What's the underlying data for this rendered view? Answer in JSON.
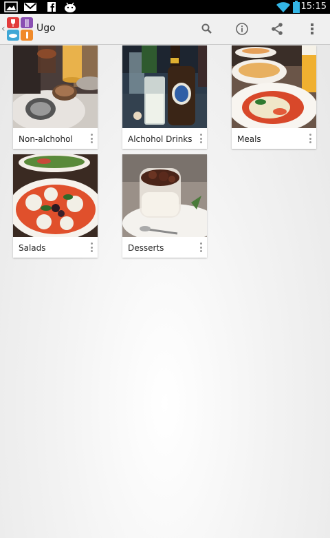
{
  "status_bar": {
    "time": "15:15",
    "icons": [
      "image-notification-icon",
      "gmail-icon",
      "facebook-icon",
      "android-icon",
      "wifi-icon",
      "battery-icon"
    ]
  },
  "action_bar": {
    "title": "Ugo",
    "actions": [
      "search-icon",
      "info-icon",
      "share-icon",
      "overflow-menu-icon"
    ]
  },
  "categories": [
    {
      "label": "Non-alchohol"
    },
    {
      "label": "Alchohol Drinks"
    },
    {
      "label": "Meals"
    },
    {
      "label": "Salads"
    },
    {
      "label": "Desserts"
    }
  ],
  "colors": {
    "status_bar": "#000000",
    "action_bar": "#f0f0f0",
    "wifi": "#33b5e5"
  }
}
